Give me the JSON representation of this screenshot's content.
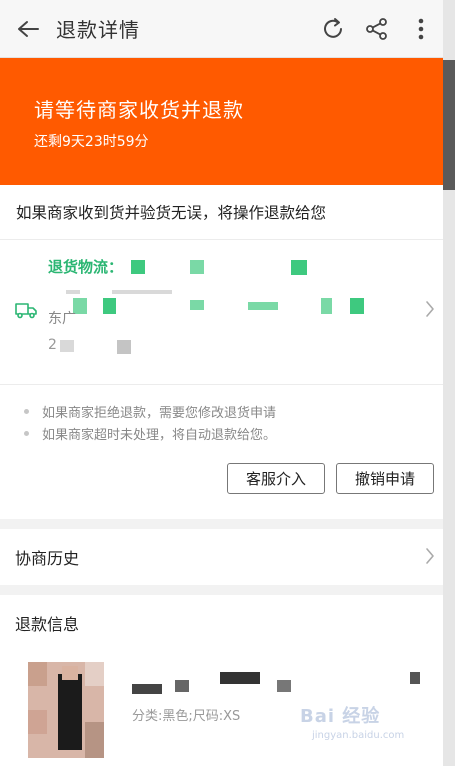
{
  "header": {
    "title": "退款详情",
    "back_icon": "arrow-left-icon",
    "refresh_icon": "refresh-icon",
    "share_icon": "share-icon",
    "more_icon": "more-vertical-icon"
  },
  "banner": {
    "status": "请等待商家收货并退款",
    "countdown": "还剩9天23时59分",
    "color": "#ff5a00"
  },
  "notice": "如果商家收到货并验货无误，将操作退款给您",
  "logistics": {
    "title": "退货物流：",
    "line2_prefix": "东广",
    "line3_prefix": "2",
    "accent": "#2bb673"
  },
  "tips": [
    "如果商家拒绝退款，需要您修改退货申请",
    "如果商家超时未处理，将自动退款给您。"
  ],
  "actions": {
    "service": "客服介入",
    "cancel": "撤销申请"
  },
  "sections": {
    "history": "协商历史",
    "refund_info": "退款信息"
  },
  "product": {
    "spec": "分类:黑色;尺码:XS",
    "watermark": "Bai 经验",
    "watermark_sub": "jingyan.baidu.com"
  }
}
